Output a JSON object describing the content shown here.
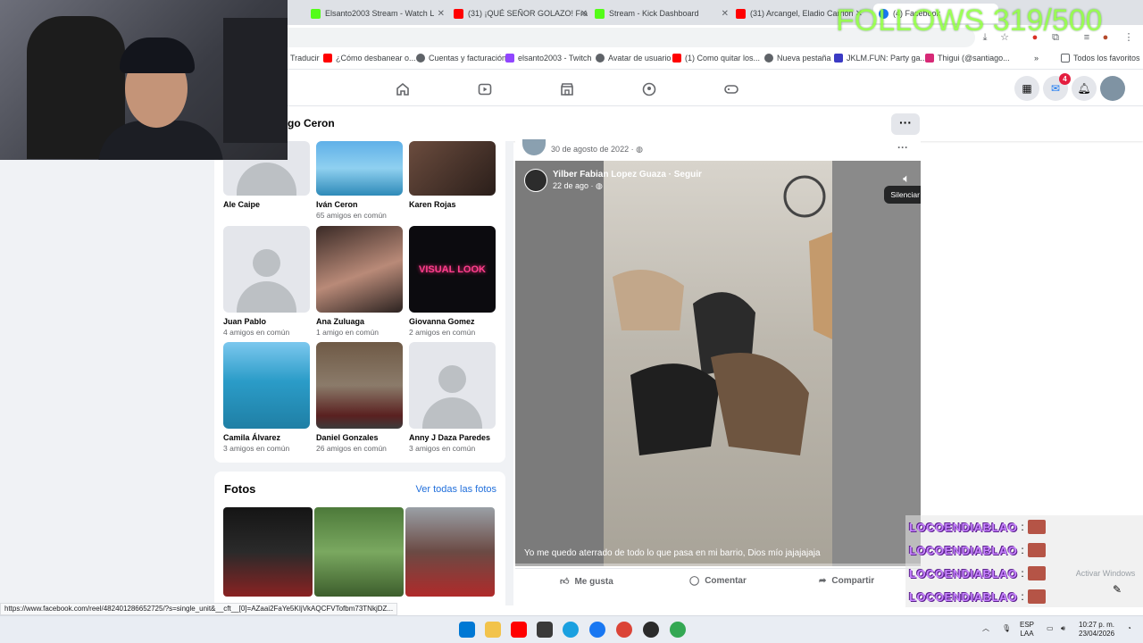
{
  "overlay": {
    "follows_goal": "FOLLOWS 319/500"
  },
  "browser": {
    "tabs": [
      {
        "label": "Elsanto2003 Stream - Watch L",
        "color": "#53fc18"
      },
      {
        "label": "(31) ¡QUÉ SEÑOR GOLAZO! Fra",
        "color": "#ff0000"
      },
      {
        "label": "Stream - Kick Dashboard",
        "color": "#53fc18"
      },
      {
        "label": "(31) Arcangel, Eladio Carrión",
        "color": "#ff0000"
      },
      {
        "label": "(4) Facebook",
        "color": "#1877f2"
      }
    ],
    "bookmarks": [
      {
        "label": "Traducir",
        "color": "#4285f4"
      },
      {
        "label": "¿Cómo desbanear o...",
        "color": "#ff0000"
      },
      {
        "label": "Cuentas y facturación",
        "color": "#5f6368"
      },
      {
        "label": "elsanto2003 - Twitch",
        "color": "#9146ff"
      },
      {
        "label": "Avatar de usuario",
        "color": "#5f6368"
      },
      {
        "label": "(1) Como quitar los...",
        "color": "#ff0000"
      },
      {
        "label": "Nueva pestaña",
        "color": "#5f6368"
      },
      {
        "label": "JKLM.FUN: Party ga...",
        "color": "#3b3bc4"
      },
      {
        "label": "Thigui (@santiago...",
        "color": "#d62976"
      }
    ],
    "all_favorites": "Todos los favoritos",
    "status_url": "https://www.facebook.com/reel/482401286652725/?s=single_unit&__cft__[0]=AZaai2FaYe5KIjVkAQCFVTofbm73TNkjDZ..."
  },
  "facebook": {
    "notifications_count": "4",
    "profile_name": "go Ceron",
    "friends": [
      {
        "name": "Ale Caipe",
        "mutual": "",
        "photo": "blank-partial"
      },
      {
        "name": "Iván Ceron",
        "mutual": "65 amigos en común",
        "photo": "beach"
      },
      {
        "name": "Karen Rojas",
        "mutual": "",
        "photo": "portrait"
      },
      {
        "name": "Juan Pablo",
        "mutual": "4 amigos en común",
        "photo": "blank"
      },
      {
        "name": "Ana Zuluaga",
        "mutual": "1 amigo en común",
        "photo": "selfie"
      },
      {
        "name": "Giovanna Gomez",
        "mutual": "2 amigos en común",
        "photo": "neon"
      },
      {
        "name": "Camila Álvarez",
        "mutual": "3 amigos en común",
        "photo": "sea"
      },
      {
        "name": "Daniel Gonzales",
        "mutual": "26 amigos en común",
        "photo": "street"
      },
      {
        "name": "Anny J Daza Paredes",
        "mutual": "3 amigos en común",
        "photo": "blank"
      }
    ],
    "neon_text": "VISUAL LOOK",
    "photos_title": "Fotos",
    "photos_link": "Ver todas las fotos",
    "post": {
      "date": "30 de agosto de 2022 · ",
      "video_author": "Yilber Fabian Lopez Guaza · Seguir",
      "video_time": "22 de ago · ",
      "mute_tooltip": "Silenciar",
      "caption": "Yo me quedo aterrado de todo lo que pasa en mi barrio, Dios mío jajajajaja",
      "like": "Me gusta",
      "comment": "Comentar",
      "share": "Compartir"
    }
  },
  "chat": {
    "lines": [
      {
        "user": "LOCOENDIABLAO",
        "sep": ":"
      },
      {
        "user": "LOCOENDIABLAO",
        "sep": ":"
      },
      {
        "user": "LOCOENDIABLAO",
        "sep": ":"
      },
      {
        "user": "LOCOENDIABLAO",
        "sep": ":"
      }
    ],
    "watermark": "Activar Windows"
  },
  "taskbar": {
    "lang_top": "ESP",
    "lang_bottom": "LAA",
    "time": "10:27 p. m.",
    "date": "23/04/2026"
  }
}
